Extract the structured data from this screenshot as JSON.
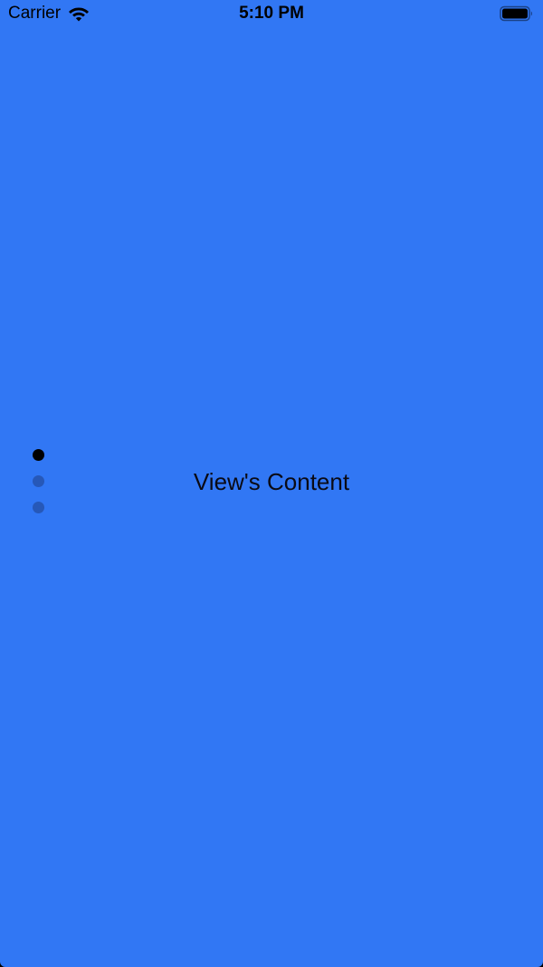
{
  "colors": {
    "background": "#3177f4",
    "dot_active": "#000000",
    "dot_inactive": "#2658b8"
  },
  "status_bar": {
    "carrier": "Carrier",
    "time": "5:10 PM",
    "icons": [
      "wifi-icon",
      "battery-icon"
    ]
  },
  "main": {
    "content_text": "View's Content"
  },
  "page_indicator": {
    "count": 3,
    "current_index": 0
  }
}
